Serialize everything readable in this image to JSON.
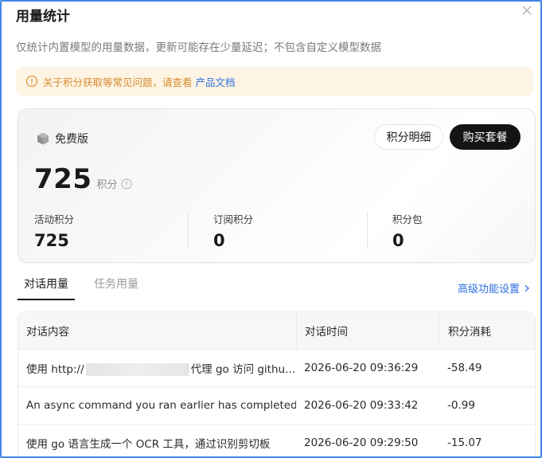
{
  "dialog": {
    "title": "用量统计",
    "subtitle": "仅统计内置模型的用量数据，更新可能存在少量延迟；不包含自定义模型数据"
  },
  "notice": {
    "text": "关于积分获取等常见问题，请查看",
    "link": "产品文档",
    "color": "#d88a2e"
  },
  "plan": {
    "name": "免费版",
    "credits": "725",
    "credits_unit": "积分",
    "detail_button": "积分明细",
    "buy_button": "购买套餐",
    "stats": [
      {
        "label": "活动积分",
        "value": "725"
      },
      {
        "label": "订阅积分",
        "value": "0"
      },
      {
        "label": "积分包",
        "value": "0"
      }
    ]
  },
  "tabs": [
    {
      "label": "对话用量",
      "active": true
    },
    {
      "label": "任务用量",
      "active": false
    }
  ],
  "advanced_link": "高级功能设置",
  "table": {
    "columns": [
      "对话内容",
      "对话时间",
      "积分消耗"
    ],
    "rows": [
      {
        "content_prefix": "使用 http://",
        "content_suffix": "代理 go 访问 githu...",
        "redacted": true,
        "time": "2026-06-20 09:36:29",
        "cost": "-58.49"
      },
      {
        "content": "An async command you ran earlier has completed...",
        "time": "2026-06-20 09:33:42",
        "cost": "-0.99"
      },
      {
        "content": "使用 go 语言生成一个 OCR 工具，通过识别剪切板",
        "time": "2026-06-20 09:29:50",
        "cost": "-15.07"
      }
    ]
  },
  "colors": {
    "accent_link": "#2f6fdc",
    "frame_border": "#3f86e6",
    "buy_button_bg": "#141414"
  }
}
